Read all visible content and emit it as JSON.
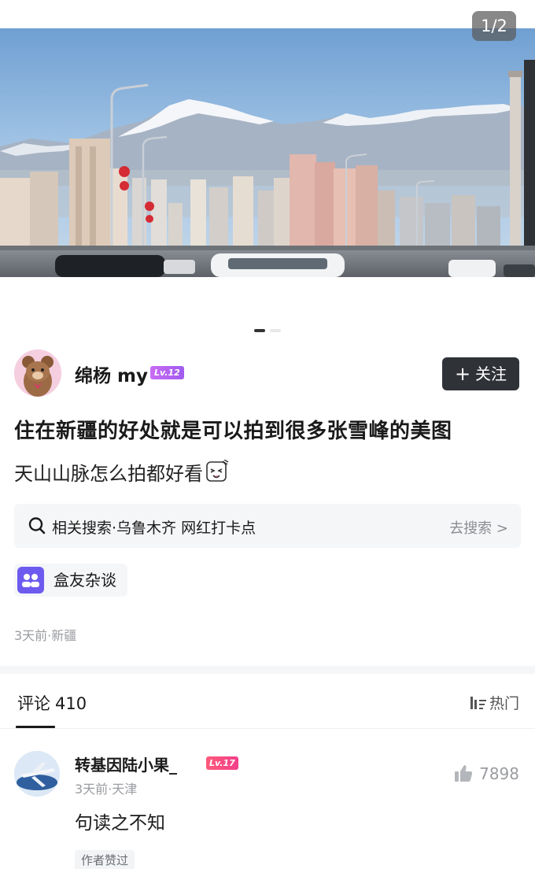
{
  "gallery": {
    "counter": "1/2",
    "image_description_icon": "cityscape-photo"
  },
  "author": {
    "name": "绵杨 my",
    "level": "Lv.12",
    "follow_label": "关注",
    "follow_icon": "plus-icon"
  },
  "post": {
    "title": "住在新疆的好处就是可以拍到很多张雪峰的美图",
    "body": "天山山脉怎么拍都好看"
  },
  "related_search": {
    "text": "相关搜索·乌鲁木齐 网红打卡点",
    "action": "去搜索 >"
  },
  "circle": {
    "name": "盒友杂谈"
  },
  "meta": "3天前·新疆",
  "comments": {
    "tab_label": "评论",
    "count": "410",
    "sort_label": "热门",
    "items": [
      {
        "name": "转基因陆小果_",
        "level": "Lv.17",
        "meta": "3天前·天津",
        "likes": "7898",
        "text": "句读之不知",
        "tag": "作者赞过"
      }
    ]
  },
  "colors": {
    "follow_bg": "#2f3237",
    "circle_icon": "#6d5bf0",
    "lv_author": "#b563f1",
    "lv_commenter": "#f2408a",
    "muted_text": "#9a9ca1"
  }
}
